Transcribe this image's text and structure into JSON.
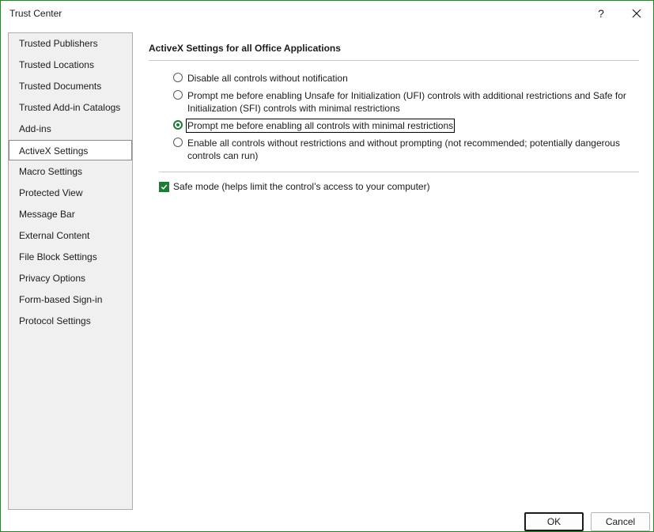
{
  "window": {
    "title": "Trust Center",
    "help_label": "?"
  },
  "sidebar": {
    "items": [
      {
        "label": "Trusted Publishers"
      },
      {
        "label": "Trusted Locations"
      },
      {
        "label": "Trusted Documents"
      },
      {
        "label": "Trusted Add-in Catalogs"
      },
      {
        "label": "Add-ins"
      },
      {
        "label": "ActiveX Settings",
        "selected": true
      },
      {
        "label": "Macro Settings"
      },
      {
        "label": "Protected View"
      },
      {
        "label": "Message Bar"
      },
      {
        "label": "External Content"
      },
      {
        "label": "File Block Settings"
      },
      {
        "label": "Privacy Options"
      },
      {
        "label": "Form-based Sign-in"
      },
      {
        "label": "Protocol Settings"
      }
    ]
  },
  "main": {
    "section_title": "ActiveX Settings for all Office Applications",
    "options": [
      {
        "label": "Disable all controls without notification",
        "checked": false
      },
      {
        "label_line1": "Prompt me before enabling Unsafe for Initialization (UFI) controls with additional restrictions and Safe for",
        "label_line2": "Initialization (SFI) controls with minimal restrictions",
        "checked": false
      },
      {
        "label": "Prompt me before enabling all controls with minimal restrictions",
        "checked": true
      },
      {
        "label_line1": "Enable all controls without restrictions and without prompting (not recommended; potentially dangerous",
        "label_line2": "controls can run)",
        "checked": false
      }
    ],
    "safe_mode": {
      "label": "Safe mode (helps limit the control’s access to your computer)",
      "checked": true
    }
  },
  "footer": {
    "ok_label": "OK",
    "cancel_label": "Cancel"
  },
  "colors": {
    "accent": "#1f7a3a",
    "sidebar_bg": "#f0f0f0"
  }
}
